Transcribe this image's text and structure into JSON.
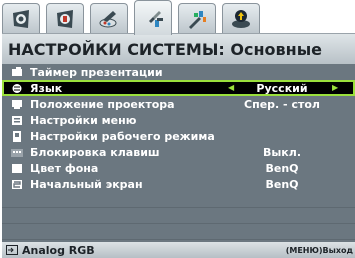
{
  "tabs": [
    {
      "icon": "picture-settings-icon",
      "active": false
    },
    {
      "icon": "advanced-picture-icon",
      "active": false
    },
    {
      "icon": "system-setup-basic-icon",
      "active": true
    },
    {
      "icon": "system-setup-advanced-icon",
      "active": false
    },
    {
      "icon": "information-icon",
      "active": false
    }
  ],
  "menu": {
    "title": "НАСТРОЙКИ СИСТЕМЫ: Основные",
    "rows": [
      {
        "icon": "presentation-timer-icon",
        "label": "Таймер презентации",
        "value": ""
      },
      {
        "icon": "language-icon",
        "label": "Язык",
        "value": "Русский",
        "selected": true
      },
      {
        "icon": "projector-position-icon",
        "label": "Положение проектора",
        "value": "Спер. - стол"
      },
      {
        "icon": "menu-settings-icon",
        "label": "Настройки меню",
        "value": ""
      },
      {
        "icon": "operation-settings-icon",
        "label": "Настройки рабочего режима",
        "value": ""
      },
      {
        "icon": "keypad-lock-icon",
        "label": "Блокировка клавиш",
        "value": "Выкл."
      },
      {
        "icon": "background-color-icon",
        "label": "Цвет фона",
        "value": "BenQ"
      },
      {
        "icon": "splash-screen-icon",
        "label": "Начальный экран",
        "value": "BenQ"
      }
    ]
  },
  "footer": {
    "source": "Analog RGB",
    "menu_key": "МЕНЮ",
    "exit_label": "Выход"
  },
  "colors": {
    "highlight": "#9be03c",
    "panel": "#6b7780"
  }
}
